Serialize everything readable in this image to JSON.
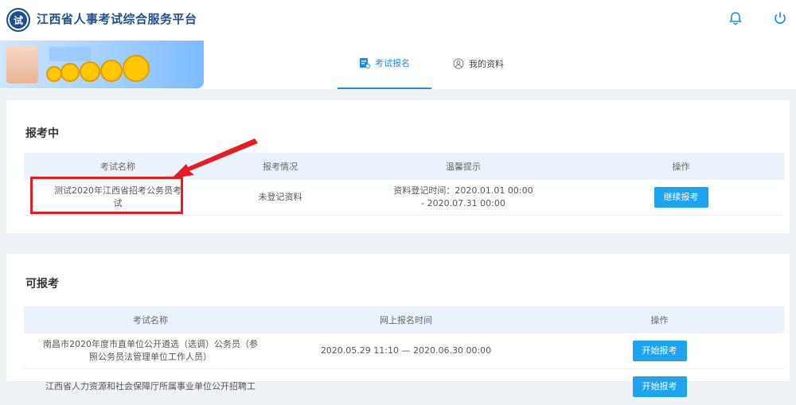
{
  "app": {
    "title": "江西省人事考试综合服务平台",
    "logo_text": "试"
  },
  "header_icons": [
    "bell-icon",
    "power-icon"
  ],
  "tabs": [
    {
      "label": "考试报名",
      "icon": "exam-register-icon",
      "active": true
    },
    {
      "label": "我的资料",
      "icon": "profile-icon",
      "active": false
    }
  ],
  "applying": {
    "title": "报考中",
    "columns": [
      "考试名称",
      "报考情况",
      "温馨提示",
      "操作"
    ],
    "rows": [
      {
        "name_line1": "测试2020年江西省招考公务员考",
        "name_line2": "试",
        "status": "未登记资料",
        "tip_line1": "资料登记时间：2020.01.01 00:00",
        "tip_line2": "- 2020.07.31 00:00",
        "action": "继续报考"
      }
    ]
  },
  "available": {
    "title": "可报考",
    "columns": [
      "考试名称",
      "网上报名时间",
      "操作"
    ],
    "rows": [
      {
        "name_line1": "南昌市2020年度市直单位公开遴选（选调）公务员（参",
        "name_line2": "照公务员法管理单位工作人员）",
        "time": "2020.05.29 11:10 — 2020.06.30 00:00",
        "action": "开始报考"
      },
      {
        "name_line1": "江西省人力资源和社会保障厅所属事业单位公开招聘工",
        "name_line2": "",
        "time": "",
        "action": "开始报考"
      }
    ]
  },
  "colors": {
    "brand": "#1f4f8f",
    "accent": "#1a8df0",
    "button": "#1ea3ef",
    "annotation": "#e51c23"
  }
}
